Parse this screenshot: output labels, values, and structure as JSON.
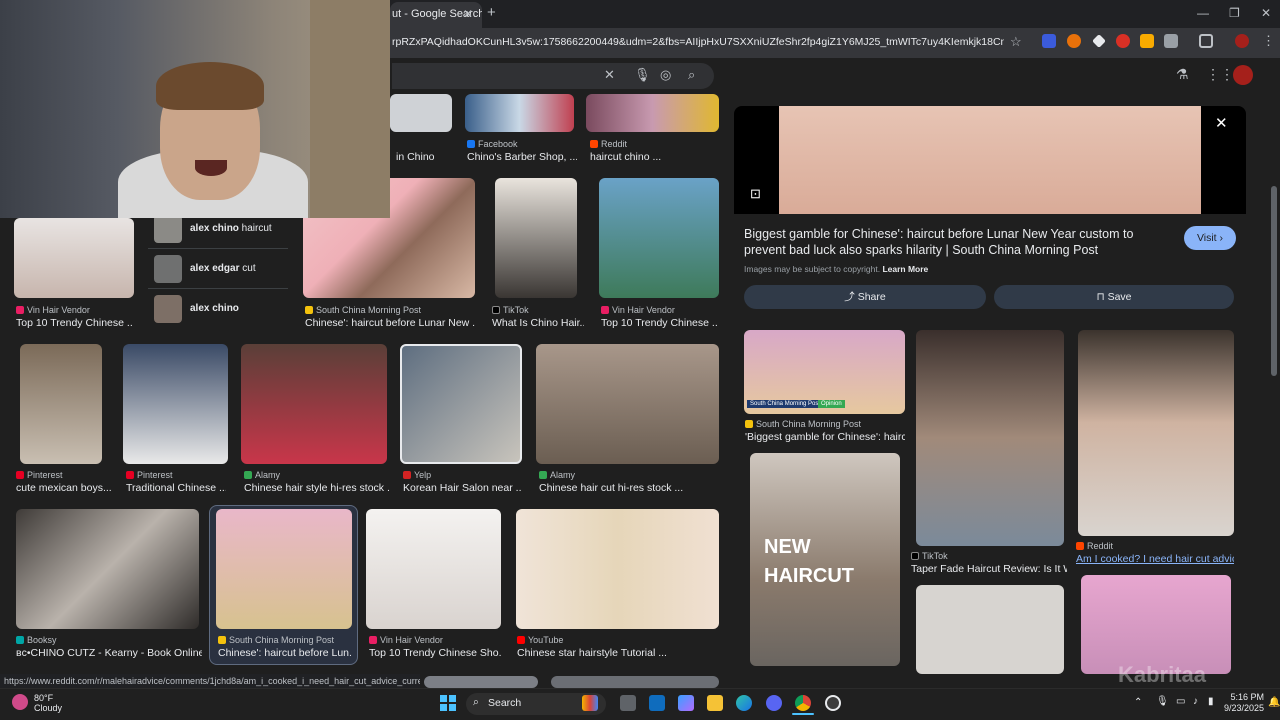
{
  "browser": {
    "tab_title": "ut - Google Search",
    "url": "rpRZxPAQidhadOKCunHL3v5w:1758662200449&udm=2&fbs=AIIjpHxU7SXXniUZfeShr2fp4giZ1Y6MJ25_tmWITc7uy4KIemkjk18Cn72Gp24fGkjjh6w8f...",
    "new_tab": "+",
    "close": "✕",
    "min": "—",
    "max": "❐"
  },
  "suggestions": [
    {
      "bold": "alex chino",
      "rest": " haircut"
    },
    {
      "bold": "alex edgar",
      "rest": " cut"
    },
    {
      "bold": "alex chino",
      "rest": ""
    }
  ],
  "results": [
    {
      "src": "Facebook",
      "cap": "Chino's Barber Shop, ...",
      "color": "#1877f2"
    },
    {
      "src": "Reddit",
      "cap": "haircut chino ...",
      "color": "#ff4500"
    },
    {
      "src": "",
      "cap": "in Chino",
      "color": "#888888"
    },
    {
      "src": "Vin Hair Vendor",
      "cap": "Top 10 Trendy Chinese ...",
      "color": "#e91e63"
    },
    {
      "src": "South China Morning Post",
      "cap": "Chinese': haircut before Lunar New ...",
      "color": "#f4c20d"
    },
    {
      "src": "TikTok",
      "cap": "What Is Chino Hair...",
      "color": "#000000"
    },
    {
      "src": "Vin Hair Vendor",
      "cap": "Top 10 Trendy Chinese ...",
      "color": "#e91e63"
    },
    {
      "src": "Pinterest",
      "cap": "cute mexican boys...",
      "color": "#e60023"
    },
    {
      "src": "Pinterest",
      "cap": "Traditional Chinese ...",
      "color": "#e60023"
    },
    {
      "src": "Alamy",
      "cap": "Chinese hair style hi-res stock ...",
      "color": "#34a853"
    },
    {
      "src": "Yelp",
      "cap": "Korean Hair Salon near ...",
      "color": "#d32323"
    },
    {
      "src": "Alamy",
      "cap": "Chinese hair cut hi-res stock ...",
      "color": "#34a853"
    },
    {
      "src": "Booksy",
      "cap": "ʙᴄ•CHINO CUTZ - Kearny - Book Online ...",
      "color": "#00a6a6"
    },
    {
      "src": "South China Morning Post",
      "cap": "Chinese': haircut before Lun...",
      "color": "#f4c20d"
    },
    {
      "src": "Vin Hair Vendor",
      "cap": "Top 10 Trendy Chinese Sho...",
      "color": "#e91e63"
    },
    {
      "src": "YouTube",
      "cap": "Chinese star hairstyle Tutorial ...",
      "color": "#ff0000"
    }
  ],
  "panel": {
    "title": "Biggest gamble for Chinese': haircut before Lunar New Year custom to prevent bad luck also sparks hilarity | South China Morning Post",
    "visit": "Visit",
    "copyright": "Images may be subject to copyright.",
    "learn_more": "Learn More",
    "share": "Share",
    "save": "Save",
    "related": [
      {
        "src": "South China Morning Post",
        "cap": "'Biggest gamble for Chinese': hairc...",
        "color": "#f4c20d"
      },
      {
        "src": "TikTok",
        "cap": "Taper Fade Haircut Review: Is It W...",
        "color": "#000000"
      },
      {
        "src": "Reddit",
        "cap": "Am I cooked? I need hair cut advic...",
        "color": "#ff4500"
      }
    ],
    "overlay_text": "NEW HAIRCUT",
    "scmp_badge": "South China Morning Post",
    "opinion_badge": "Opinion"
  },
  "status_url": "https://www.reddit.com/r/malehairadvice/comments/1jchd8a/am_i_cooked_i_need_hair_cut_advice_currently_want/",
  "taskbar": {
    "temp": "80°F",
    "weather": "Cloudy",
    "search": "Search",
    "time": "5:16 PM",
    "date": "9/23/2025"
  },
  "watermark": "Kabritaa"
}
